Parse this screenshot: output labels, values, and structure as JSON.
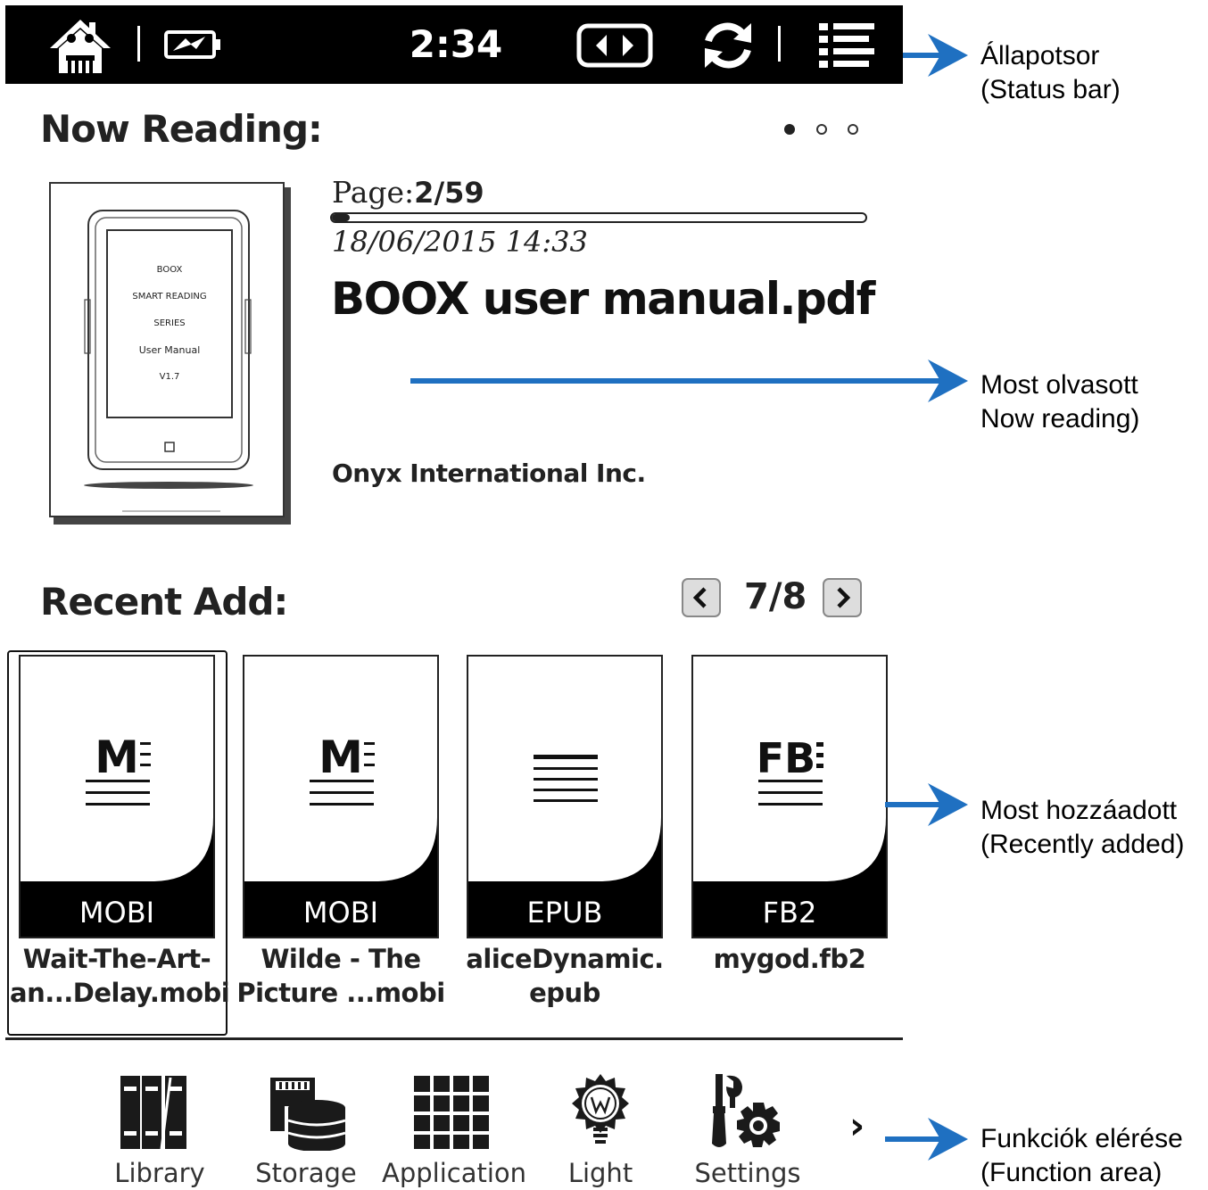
{
  "status_bar": {
    "time": "2:34",
    "icons": [
      "home-icon",
      "battery-charging-icon",
      "page-turn-icon",
      "refresh-icon",
      "menu-icon"
    ]
  },
  "now_reading": {
    "heading": "Now Reading:",
    "page_label": "Page:",
    "page_value": "2/59",
    "progress": 0.034,
    "date": "18/06/2015 14:33",
    "title": "BOOX user manual.pdf",
    "author": "Onyx International Inc.",
    "cover_lines": [
      "BOOX",
      "SMART READING",
      "SERIES",
      "User Manual",
      "V1.7"
    ],
    "pagination_dots": 3,
    "active_dot": 0
  },
  "recent_add": {
    "heading": "Recent Add:",
    "pager": "7/8",
    "items": [
      {
        "format": "MOBI",
        "logo": "M",
        "name_line1": "Wait-The-Art-",
        "name_line2": "an...Delay.mobi",
        "selected": true
      },
      {
        "format": "MOBI",
        "logo": "M",
        "name_line1": "Wilde - The",
        "name_line2": "Picture ...mobi",
        "selected": false
      },
      {
        "format": "EPUB",
        "logo": "",
        "name_line1": "aliceDynamic.",
        "name_line2": "epub",
        "selected": false
      },
      {
        "format": "FB2",
        "logo": "FB",
        "name_line1": "mygod.fb2",
        "name_line2": "",
        "selected": false
      }
    ]
  },
  "function_bar": {
    "items": [
      {
        "label": "Library",
        "icon": "library-icon"
      },
      {
        "label": "Storage",
        "icon": "storage-icon"
      },
      {
        "label": "Application",
        "icon": "application-grid-icon"
      },
      {
        "label": "Light",
        "icon": "light-bulb-icon"
      },
      {
        "label": "Settings",
        "icon": "settings-tools-icon"
      }
    ],
    "more": "›"
  },
  "callouts": {
    "status_bar": [
      "Állapotsor",
      "(Status bar)"
    ],
    "now_reading": [
      "Most olvasott",
      "Now reading)"
    ],
    "recently_added": [
      "Most hozzáadott",
      "(Recently added)"
    ],
    "function_area": [
      "Funkciók elérése",
      "(Function area)"
    ],
    "arrow_color": "#1f70c1"
  }
}
